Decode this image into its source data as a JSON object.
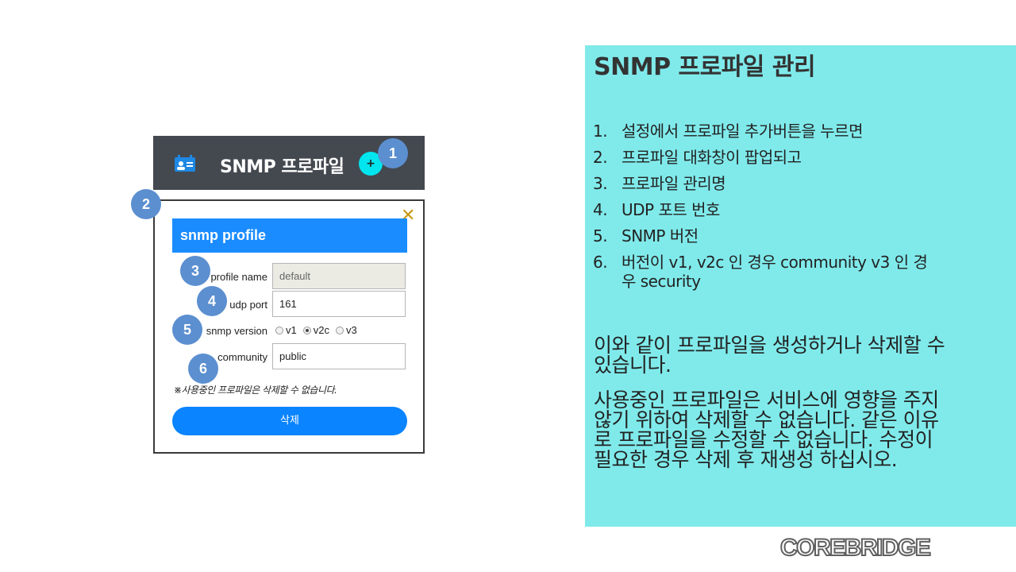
{
  "header": {
    "title": "SNMP 프로파일",
    "add_label": "+"
  },
  "dialog": {
    "title": "snmp profile",
    "close_label": "✕",
    "profile_name_label": "profile name",
    "profile_name_value": "default",
    "udp_port_label": "udp port",
    "udp_port_value": "161",
    "snmp_version_label": "snmp version",
    "versions": [
      {
        "label": "v1",
        "checked": false
      },
      {
        "label": "v2c",
        "checked": true
      },
      {
        "label": "v3",
        "checked": false
      }
    ],
    "community_label": "community",
    "community_value": "public",
    "note": "※사용중인 프로파일은 삭제할 수 없습니다.",
    "delete_label": "삭제"
  },
  "badges": [
    "1",
    "2",
    "3",
    "4",
    "5",
    "6"
  ],
  "panel": {
    "title": "SNMP 프로파일 관리",
    "steps": [
      {
        "num": "1.",
        "text": "설정에서 프로파일 추가버튼을 누르면"
      },
      {
        "num": "2.",
        "text": "프로파일 대화창이 팝업되고"
      },
      {
        "num": "3.",
        "text": "프로파일 관리명"
      },
      {
        "num": "4.",
        "text": "UDP 포트 번호"
      },
      {
        "num": "5.",
        "text": "SNMP 버전"
      },
      {
        "num": "6.",
        "text": "버전이 v1, v2c 인 경우 community v3 인 경우 security"
      }
    ],
    "paragraph1": "이와 같이 프로파일을 생성하거나 삭제할 수 있습니다.",
    "paragraph2": "사용중인 프로파일은 서비스에 영향을 주지 않기 위하여 삭제할 수 없습니다. 같은 이유로 프로파일을 수정할 수 없습니다. 수정이 필요한 경우 삭제 후 재생성 하십시오."
  },
  "logo": "COREBRIDGE",
  "colors": {
    "header_bg": "#444950",
    "add_button": "#00e5ee",
    "dialog_title_bg": "#1a8cff",
    "delete_button": "#0a84ff",
    "badge": "#5b8fd0",
    "panel_bg": "#80eaeb",
    "close_icon": "#c79a12"
  },
  "icons": {
    "header_icon": "profile-card-icon",
    "close_icon": "close-icon"
  }
}
